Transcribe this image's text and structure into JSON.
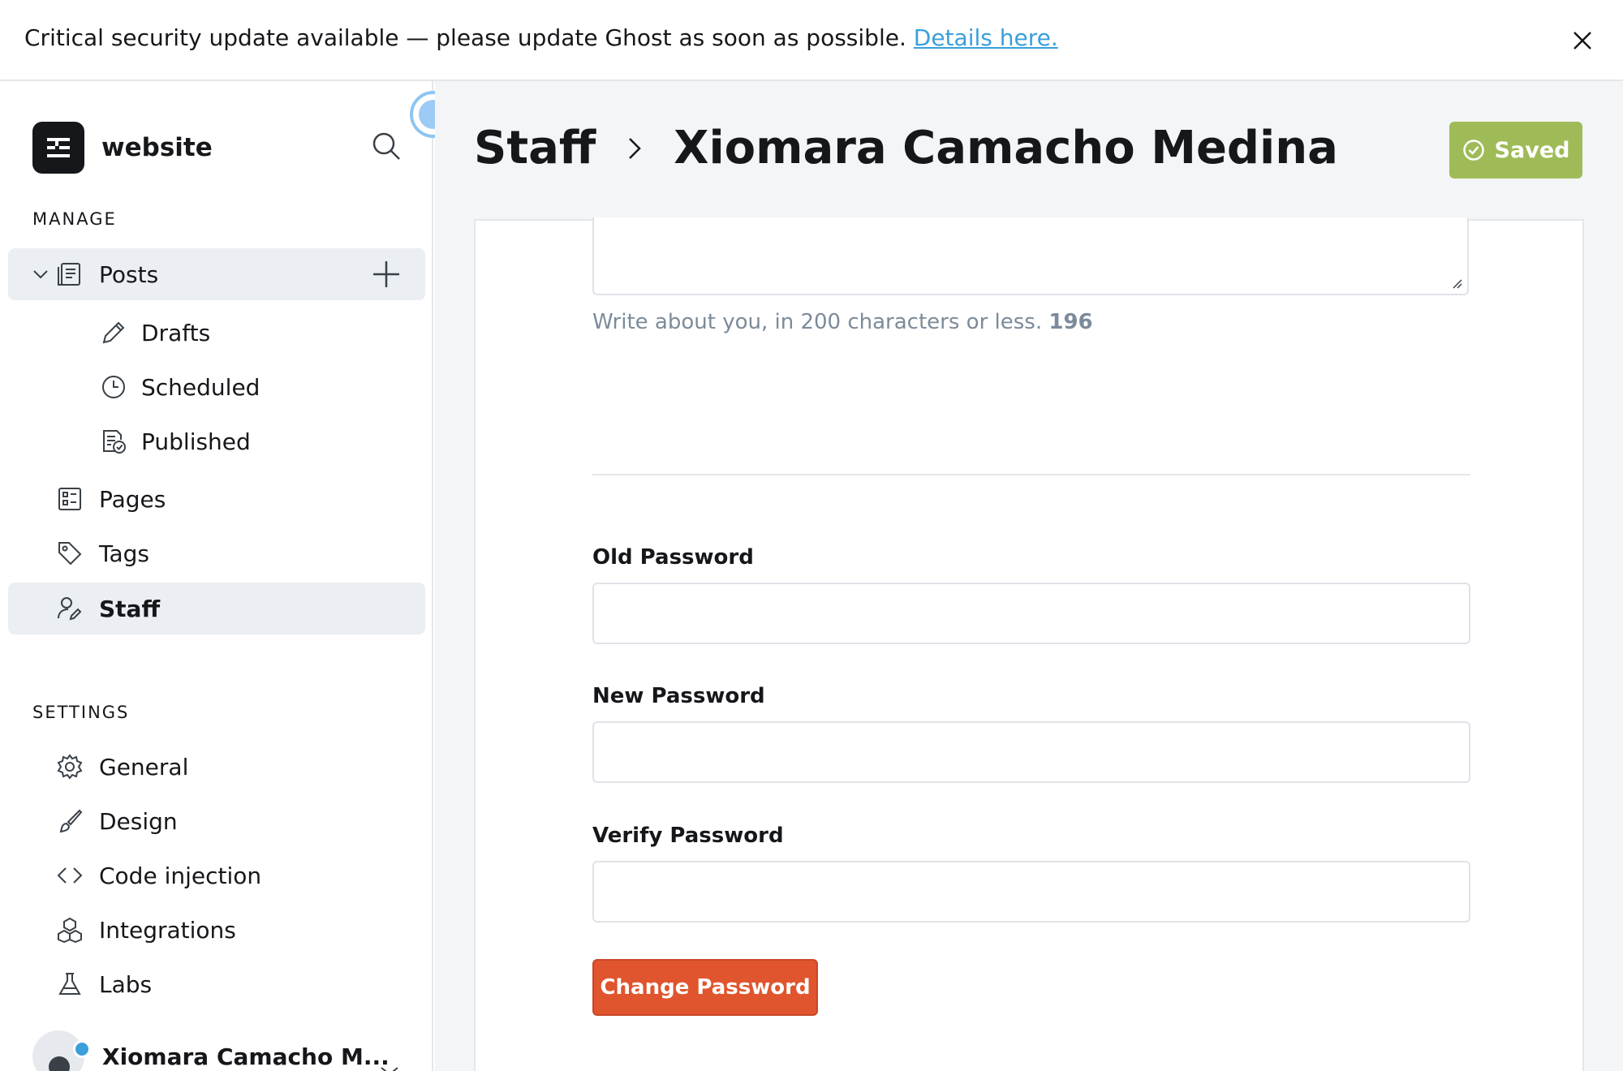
{
  "banner": {
    "message": "Critical security update available — please update Ghost as soon as possible.",
    "link_text": "Details here."
  },
  "sidebar": {
    "site_name": "website",
    "manage_label": "MANAGE",
    "settings_label": "SETTINGS",
    "manage_items": [
      {
        "label": "Posts",
        "icon": "posts-icon"
      },
      {
        "label": "Drafts",
        "icon": "pencil-icon"
      },
      {
        "label": "Scheduled",
        "icon": "clock-icon"
      },
      {
        "label": "Published",
        "icon": "published-icon"
      },
      {
        "label": "Pages",
        "icon": "pages-icon"
      },
      {
        "label": "Tags",
        "icon": "tag-icon"
      },
      {
        "label": "Staff",
        "icon": "staff-icon"
      }
    ],
    "settings_items": [
      {
        "label": "General",
        "icon": "gear-icon"
      },
      {
        "label": "Design",
        "icon": "brush-icon"
      },
      {
        "label": "Code injection",
        "icon": "code-icon"
      },
      {
        "label": "Integrations",
        "icon": "cubes-icon"
      },
      {
        "label": "Labs",
        "icon": "flask-icon"
      }
    ],
    "user_name": "Xiomara Camacho M..."
  },
  "header": {
    "crumb_parent": "Staff",
    "crumb_current": "Xiomara Camacho Medina",
    "saved_label": "Saved"
  },
  "form": {
    "bio_hint": "Write about you, in 200 characters or less.",
    "bio_count": "196",
    "old_password_label": "Old Password",
    "new_password_label": "New Password",
    "verify_password_label": "Verify Password",
    "old_password_value": "",
    "new_password_value": "",
    "verify_password_value": "",
    "change_button": "Change Password"
  },
  "colors": {
    "accent_green": "#9fbb58",
    "danger_red": "#e0552d",
    "link_blue": "#3a9fdb"
  }
}
